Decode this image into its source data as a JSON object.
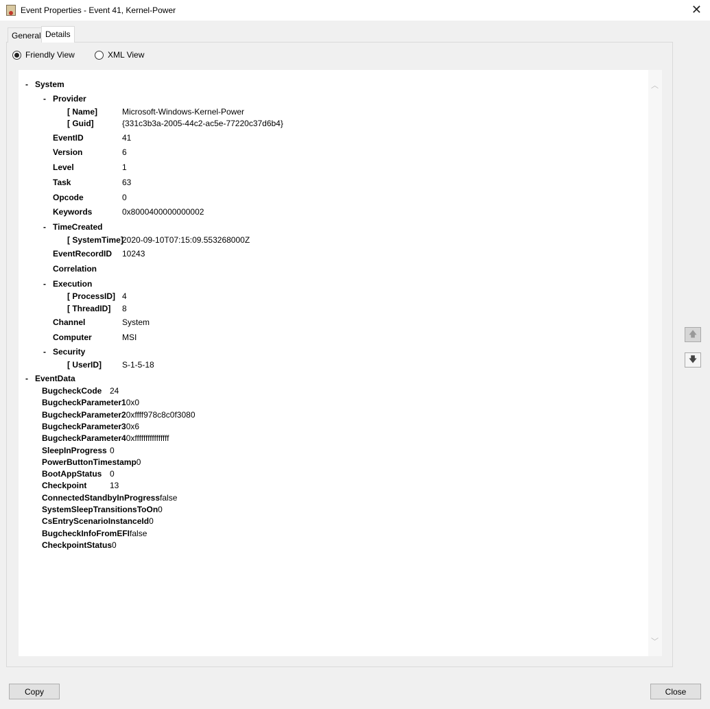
{
  "window": {
    "title": "Event Properties - Event 41, Kernel-Power",
    "close": "✕"
  },
  "tabs": [
    "General",
    "Details"
  ],
  "views": {
    "friendly": "Friendly View",
    "xml": "XML View"
  },
  "system": {
    "label": "System",
    "provider": "Provider",
    "name_k": "[ Name]",
    "name_v": "Microsoft-Windows-Kernel-Power",
    "guid_k": "[ Guid]",
    "guid_v": "{331c3b3a-2005-44c2-ac5e-77220c37d6b4}",
    "fields": [
      [
        "EventID",
        "41"
      ],
      [
        "Version",
        "6"
      ],
      [
        "Level",
        "1"
      ],
      [
        "Task",
        "63"
      ],
      [
        "Opcode",
        "0"
      ],
      [
        "Keywords",
        "0x8000400000000002"
      ]
    ],
    "timecreated": "TimeCreated",
    "systemtime_k": "[ SystemTime]",
    "systemtime_v": "2020-09-10T07:15:09.553268000Z",
    "recordid_k": "EventRecordID",
    "recordid_v": "10243",
    "correlation": "Correlation",
    "execution": "Execution",
    "pid_k": "[ ProcessID]",
    "pid_v": "4",
    "tid_k": "[ ThreadID]",
    "tid_v": "8",
    "channel_k": "Channel",
    "channel_v": "System",
    "computer_k": "Computer",
    "computer_v": "MSI",
    "security": "Security",
    "userid_k": "[ UserID]",
    "userid_v": "S-1-5-18"
  },
  "eventdata": {
    "label": "EventData",
    "rows": [
      [
        "BugcheckCode",
        "24"
      ],
      [
        "BugcheckParameter1",
        "0x0"
      ],
      [
        "BugcheckParameter2",
        "0xffff978c8c0f3080"
      ],
      [
        "BugcheckParameter3",
        "0x6"
      ],
      [
        "BugcheckParameter4",
        "0xffffffffffffffff"
      ],
      [
        "SleepInProgress",
        "0"
      ],
      [
        "PowerButtonTimestamp",
        "0"
      ],
      [
        "BootAppStatus",
        "0"
      ],
      [
        "Checkpoint",
        "13"
      ],
      [
        "ConnectedStandbyInProgress",
        "false"
      ],
      [
        "SystemSleepTransitionsToOn",
        "0"
      ],
      [
        "CsEntryScenarioInstanceId",
        "0"
      ],
      [
        "BugcheckInfoFromEFI",
        "false"
      ],
      [
        "CheckpointStatus",
        "0"
      ]
    ]
  },
  "collapse": "-",
  "buttons": {
    "copy": "Copy",
    "close": "Close"
  }
}
